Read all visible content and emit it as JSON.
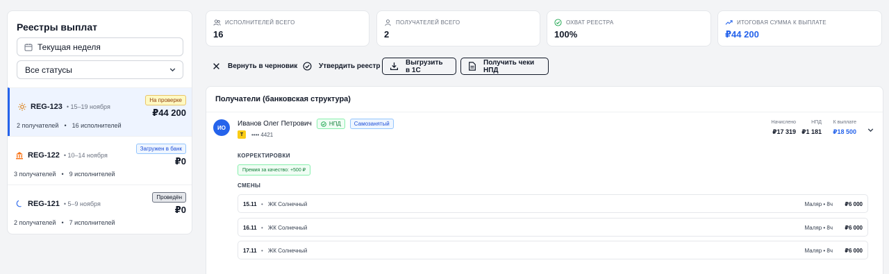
{
  "sidebar": {
    "title": "Реестры выплат",
    "week_filter": "Текущая неделя",
    "status_filter": "Все статусы",
    "registries": [
      {
        "id": "REG-123",
        "dates": "15–19 ноября",
        "status": "На проверке",
        "amount": "₽44 200",
        "recipients": "2 получателей",
        "performers": "16 исполнителей",
        "icon": "sun-icon"
      },
      {
        "id": "REG-122",
        "dates": "10–14 ноября",
        "status": "Загружен в банк",
        "amount": "₽0",
        "recipients": "3 получателей",
        "performers": "9 исполнителей",
        "icon": "bank-icon"
      },
      {
        "id": "REG-121",
        "dates": "5–9 ноября",
        "status": "Проведён",
        "amount": "₽0",
        "recipients": "2 получателей",
        "performers": "7 исполнителей",
        "icon": "moon-icon"
      }
    ]
  },
  "stats": {
    "performers": {
      "label": "Исполнителей всего",
      "value": "16"
    },
    "recipients": {
      "label": "Получателей всего",
      "value": "2"
    },
    "coverage": {
      "label": "Охват реестра",
      "value": "100%"
    },
    "total": {
      "label": "Итоговая сумма к выплате",
      "value": "₽44 200"
    }
  },
  "actions": {
    "revert": "Вернуть в черновик",
    "approve": "Утвердить реестр",
    "export": "Выгрузить в 1С",
    "receipts": "Получить чеки НПД"
  },
  "main": {
    "title": "Получатели (банковская структура)",
    "person": {
      "initials": "ИО",
      "name": "Иванов Олег Петрович",
      "tag_npd": "НПД",
      "tag_self": "Самозанятый",
      "bank_letter": "Т",
      "card": "•••• 4421",
      "accrued_label": "Начислено",
      "accrued": "₽17 319",
      "npd_label": "НПД",
      "npd": "₽1 181",
      "payout_label": "К выплате",
      "payout": "₽18 500"
    },
    "corrections_label": "Корректировки",
    "bonus": "Премия за качество: +500 ₽",
    "shifts_label": "Смены",
    "shifts": [
      {
        "date": "15.11",
        "site": "ЖК Солнечный",
        "role": "Маляр • 8ч",
        "amount": "₽6 000"
      },
      {
        "date": "16.11",
        "site": "ЖК Солнечный",
        "role": "Маляр • 8ч",
        "amount": "₽6 000"
      },
      {
        "date": "17.11",
        "site": "ЖК Солнечный",
        "role": "Маляр • 8ч",
        "amount": "₽6 000"
      }
    ]
  }
}
